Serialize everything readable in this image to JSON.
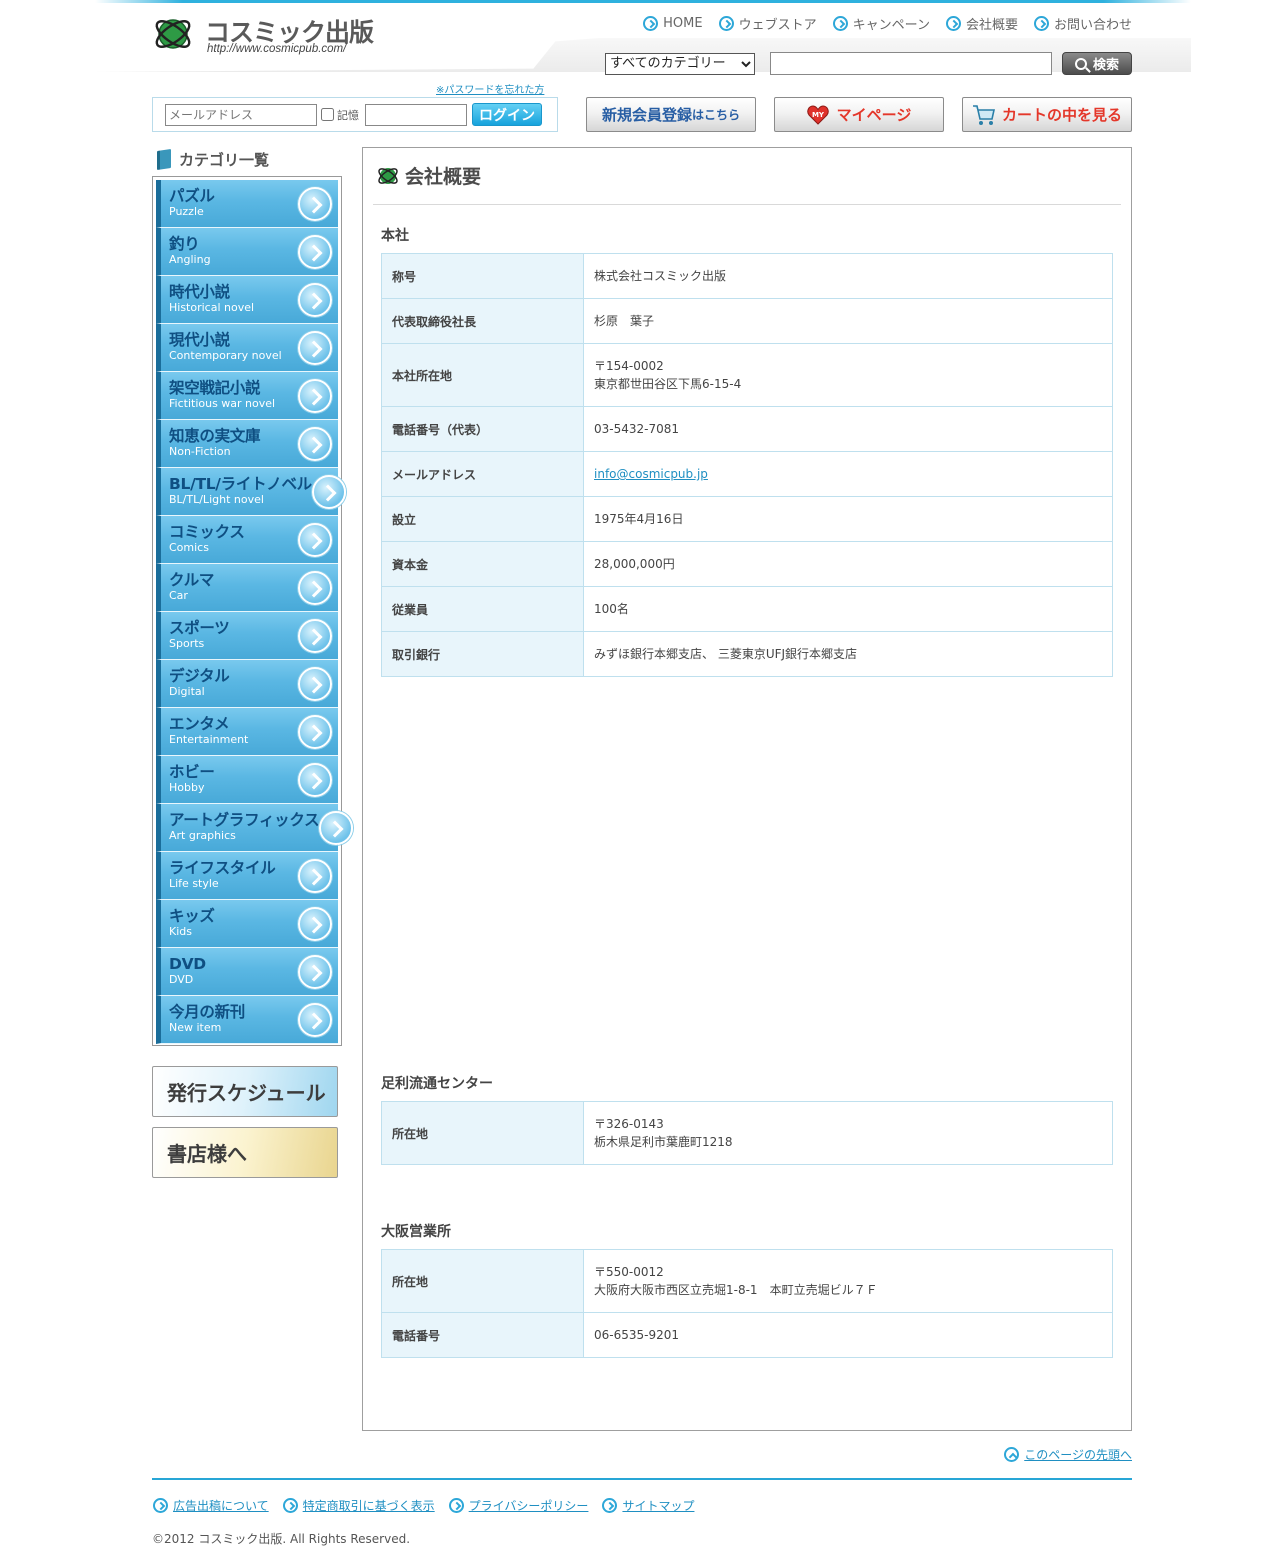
{
  "site": {
    "name": "コスミック出版",
    "url": "http://www.cosmicpub.com/"
  },
  "topnav": [
    "HOME",
    "ウェブストア",
    "キャンペーン",
    "会社概要",
    "お問い合わせ"
  ],
  "search": {
    "category_selected": "すべてのカテゴリー",
    "button": "検索"
  },
  "login": {
    "forgot": "※パスワードを忘れた方",
    "email_placeholder": "メールアドレス",
    "remember": "記憶",
    "button": "ログイン"
  },
  "buttons": {
    "register_main": "新規会員登録",
    "register_small": "はこちら",
    "mypage": "マイページ",
    "mypage_badge": "MY",
    "cart": "カートの中を見る"
  },
  "sidebar": {
    "heading": "カテゴリ一覧",
    "categories": [
      {
        "ja": "パズル",
        "en": "Puzzle"
      },
      {
        "ja": "釣り",
        "en": "Angling"
      },
      {
        "ja": "時代小説",
        "en": "Historical novel"
      },
      {
        "ja": "現代小説",
        "en": "Contemporary novel"
      },
      {
        "ja": "架空戦記小説",
        "en": "Fictitious war novel"
      },
      {
        "ja": "知恵の実文庫",
        "en": "Non-Fiction"
      },
      {
        "ja": "BL/TL/ライトノベル",
        "en": "BL/TL/Light novel"
      },
      {
        "ja": "コミックス",
        "en": "Comics"
      },
      {
        "ja": "クルマ",
        "en": "Car"
      },
      {
        "ja": "スポーツ",
        "en": "Sports"
      },
      {
        "ja": "デジタル",
        "en": "Digital"
      },
      {
        "ja": "エンタメ",
        "en": "Entertainment"
      },
      {
        "ja": "ホビー",
        "en": "Hobby"
      },
      {
        "ja": "アートグラフィックス",
        "en": "Art graphics"
      },
      {
        "ja": "ライフスタイル",
        "en": "Life style"
      },
      {
        "ja": "キッズ",
        "en": "Kids"
      },
      {
        "ja": "DVD",
        "en": "DVD"
      },
      {
        "ja": "今月の新刊",
        "en": "New item"
      }
    ],
    "banner_schedule": "発行スケジュール",
    "banner_bookstore": "書店様へ"
  },
  "main": {
    "title": "会社概要",
    "sections": [
      {
        "title": "本社",
        "rows": [
          {
            "label": "称号",
            "value": "株式会社コスミック出版"
          },
          {
            "label": "代表取締役社長",
            "value": "杉原　葉子"
          },
          {
            "label": "本社所在地",
            "value": "〒154-0002",
            "value2": "東京都世田谷区下馬6-15-4"
          },
          {
            "label": "電話番号（代表）",
            "value": "03-5432-7081"
          },
          {
            "label": "メールアドレス",
            "value": "info@cosmicpub.jp"
          },
          {
            "label": "設立",
            "value": "1975年4月16日"
          },
          {
            "label": "資本金",
            "value": "28,000,000円"
          },
          {
            "label": "従業員",
            "value": "100名"
          },
          {
            "label": "取引銀行",
            "value": "みずほ銀行本郷支店、 三菱東京UFJ銀行本郷支店"
          }
        ]
      },
      {
        "title": "足利流通センター",
        "rows": [
          {
            "label": "所在地",
            "value": "〒326-0143",
            "value2": "栃木県足利市葉鹿町1218"
          }
        ]
      },
      {
        "title": "大阪営業所",
        "rows": [
          {
            "label": "所在地",
            "value": "〒550-0012",
            "value2": "大阪府大阪市西区立売堀1-8-1　本町立売堀ビル７Ｆ"
          },
          {
            "label": "電話番号",
            "value": "06-6535-9201"
          }
        ]
      }
    ]
  },
  "footer": {
    "to_top": "このページの先頭へ",
    "links": [
      "広告出稿について",
      "特定商取引に基づく表示",
      "プライバシーポリシー",
      "サイトマップ"
    ],
    "copyright": "©2012 コスミック出版. All Rights Reserved."
  },
  "colors": {
    "accent": "#2da7d8",
    "category_bg": "#5ab7e3",
    "category_text": "#0f4f82",
    "table_header_bg": "#e8f5fb",
    "table_border": "#bfe0ee",
    "link": "#1f8fc2"
  },
  "icons": {
    "logo": "cosmic-orbit-logo",
    "nav": "circle-arrow-right-icon",
    "search": "magnifier-icon",
    "mypage": "heart-icon",
    "cart": "shopping-cart-icon",
    "category": "circle-arrow-right-icon",
    "to_top": "circle-arrow-up-icon"
  }
}
